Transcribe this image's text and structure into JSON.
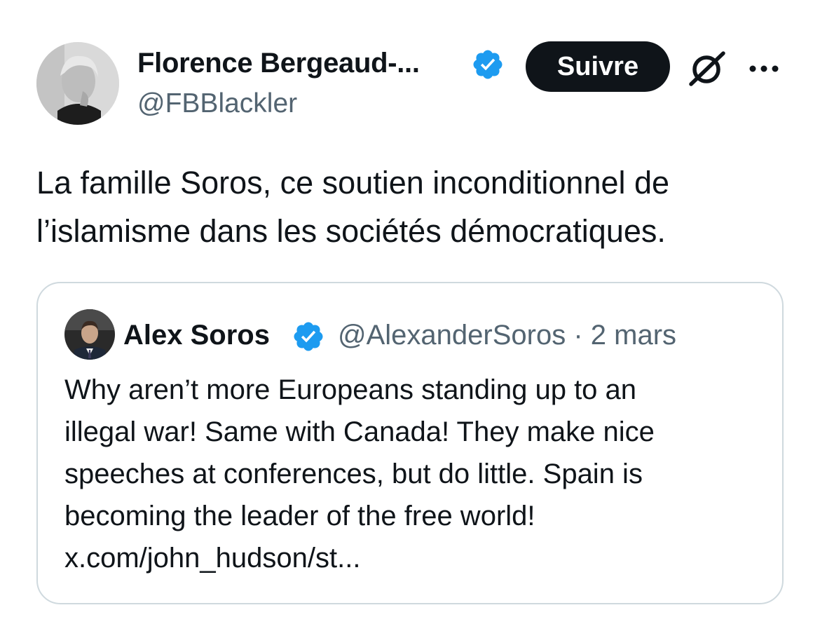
{
  "post": {
    "author_name": "Florence Bergeaud-...",
    "handle": "@FBBlackler",
    "follow_label": "Suivre",
    "text_lines": [
      "La famille Soros, ce soutien inconditionnel de",
      "l’islamisme dans les sociétés démocratiques."
    ]
  },
  "quote": {
    "author_name": "Alex Soros",
    "handle": "@AlexanderSoros",
    "separator": "·",
    "date": "2 mars",
    "text_lines": [
      "Why aren’t more Europeans standing up to an",
      "illegal war! Same with Canada! They make nice",
      "speeches at conferences, but do little. Spain is",
      "becoming the leader of the free world!",
      "x.com/john_hudson/st..."
    ]
  },
  "icons": {
    "verified": "verified-badge-icon",
    "grok": "grok-icon",
    "more": "more-options-icon"
  },
  "colors": {
    "text": "#0f1419",
    "secondary": "#536471",
    "verified": "#1d9bf0",
    "button_bg": "#0f1419",
    "button_text": "#ffffff",
    "card_border": "#cfd9de"
  }
}
